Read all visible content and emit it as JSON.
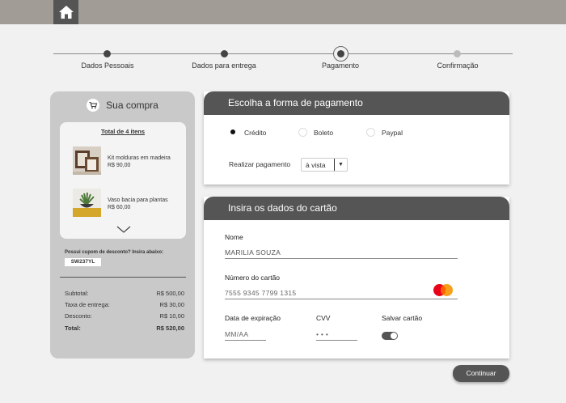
{
  "topbar": {
    "home_icon": "home-icon"
  },
  "steps": [
    {
      "label": "Dados Pessoais",
      "state": "done"
    },
    {
      "label": "Dados para entrega",
      "state": "done"
    },
    {
      "label": "Pagamento",
      "state": "current"
    },
    {
      "label": "Confirmação",
      "state": "pending"
    }
  ],
  "cart": {
    "title": "Sua compra",
    "icon": "cart-icon",
    "total_items": "Total de 4 itens",
    "items": [
      {
        "name": "Kit molduras em madeira",
        "price": "R$ 90,00"
      },
      {
        "name": "Vaso bacia para plantas",
        "price": "R$ 60,00"
      }
    ],
    "coupon_label": "Possui cupom de desconto? Insira abaixo:",
    "coupon_code": "SW237YL",
    "summary": [
      {
        "label": "Subtotal:",
        "value": "R$ 500,00"
      },
      {
        "label": "Taxa de entrega:",
        "value": "R$ 30,00"
      },
      {
        "label": "Desconto:",
        "value": "R$ 10,00"
      },
      {
        "label": "Total:",
        "value": "R$ 520,00"
      }
    ]
  },
  "payment": {
    "title": "Escolha a forma de pagamento",
    "options": [
      "Crédito",
      "Boleto",
      "Paypal"
    ],
    "selected": "Crédito",
    "installment_label": "Realizar pagamento",
    "installment_value": "à vista"
  },
  "card": {
    "title": "Insira os dados do cartão",
    "name_label": "Nome",
    "name_value": "MARILIA SOUZA",
    "number_label": "Número do cartão",
    "number_value": "7555  9345  7799  1315",
    "expiry_label": "Data de expiração",
    "expiry_value": "MM/AA",
    "cvv_label": "CVV",
    "cvv_value": "• • •",
    "save_label": "Salvar cartão",
    "save_enabled": true,
    "brand_icon": "mastercard-icon"
  },
  "actions": {
    "continue_label": "Continuar"
  },
  "colors": {
    "topbar": "#a19d96",
    "dark": "#555555",
    "background": "#f1f1f1",
    "cart_bg": "#c9c9c9"
  }
}
